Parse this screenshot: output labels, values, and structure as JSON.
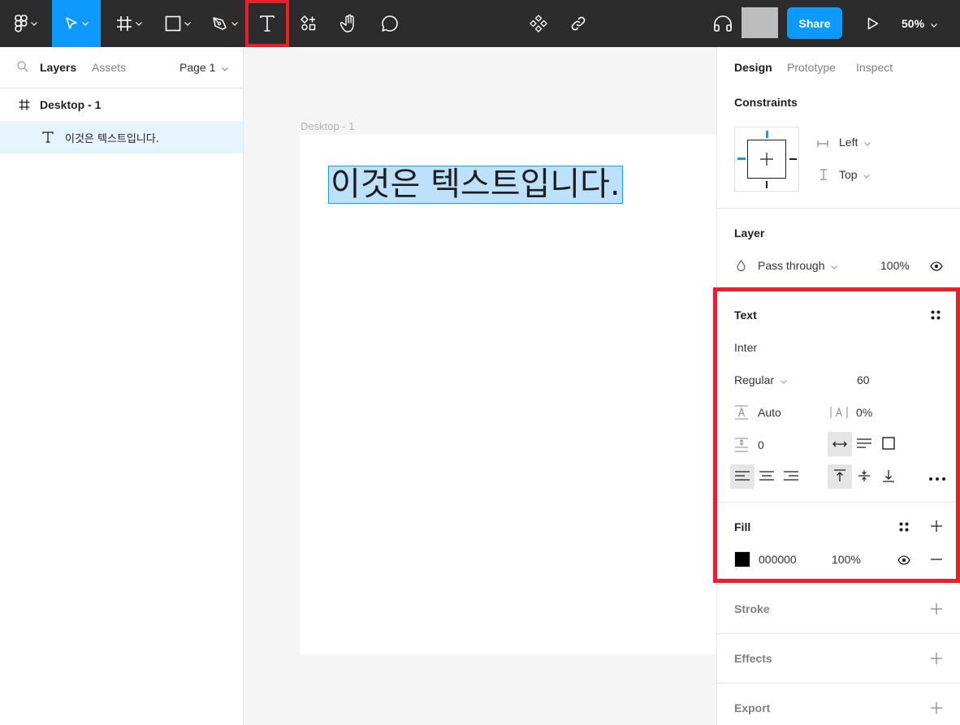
{
  "toolbar": {
    "tools": [
      {
        "name": "main-menu",
        "icon": "figma-logo-icon"
      },
      {
        "name": "move-tool",
        "icon": "cursor-arrow-icon",
        "active": true
      },
      {
        "name": "frame-tool",
        "icon": "hash-frame-icon"
      },
      {
        "name": "shape-tool",
        "icon": "rectangle-icon"
      },
      {
        "name": "pen-tool",
        "icon": "pen-icon"
      },
      {
        "name": "text-tool",
        "icon": "text-t-icon",
        "highlighted": true
      },
      {
        "name": "resources-tool",
        "icon": "resources-icon"
      },
      {
        "name": "hand-tool",
        "icon": "hand-icon"
      },
      {
        "name": "comment-tool",
        "icon": "comment-bubble-icon"
      },
      {
        "name": "components",
        "icon": "components-diamond-icon"
      },
      {
        "name": "link",
        "icon": "link-icon"
      },
      {
        "name": "audio",
        "icon": "headphones-icon"
      },
      {
        "name": "present",
        "icon": "play-icon"
      }
    ],
    "share_label": "Share",
    "zoom_label": "50%",
    "accent_color": "#0d99ff",
    "highlight_color": "#e8202a"
  },
  "left_panel": {
    "tabs": {
      "layers": "Layers",
      "assets": "Assets"
    },
    "page_label": "Page 1",
    "layers": [
      {
        "label": "Desktop - 1",
        "icon": "hash-frame-icon",
        "selected": false
      },
      {
        "label": "이것은 텍스트입니다.",
        "icon": "text-t-icon",
        "selected": true
      }
    ]
  },
  "canvas": {
    "frame_label": "Desktop - 1",
    "text_content": "이것은 텍스트입니다."
  },
  "right_panel": {
    "tabs": {
      "design": "Design",
      "prototype": "Prototype",
      "inspect": "Inspect"
    },
    "constraints": {
      "title": "Constraints",
      "horizontal": "Left",
      "vertical": "Top"
    },
    "layer": {
      "title": "Layer",
      "blend_mode": "Pass through",
      "opacity": "100%"
    },
    "text": {
      "title": "Text",
      "font_family": "Inter",
      "font_weight": "Regular",
      "font_size": "60",
      "line_height": "Auto",
      "letter_spacing": "0%",
      "paragraph_spacing": "0"
    },
    "fill": {
      "title": "Fill",
      "hex": "000000",
      "opacity": "100%",
      "color": "#000000"
    },
    "stroke_title": "Stroke",
    "effects_title": "Effects",
    "export_title": "Export"
  }
}
